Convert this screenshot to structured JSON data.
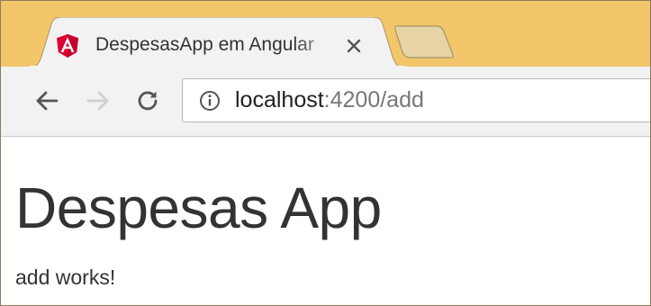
{
  "browser": {
    "tab": {
      "title": "DespesasApp em Angular",
      "favicon": "angular-logo-icon",
      "close_icon": "close-icon"
    },
    "new_tab_icon": "new-tab-icon",
    "toolbar": {
      "back_icon": "arrow-left-icon",
      "forward_icon": "arrow-right-icon",
      "reload_icon": "reload-icon",
      "info_icon": "info-icon"
    },
    "address": {
      "host": "localhost",
      "rest": ":4200/add"
    },
    "colors": {
      "tabstrip": "#f3c66b",
      "toolbar": "#f2f2f2",
      "angular_red": "#dd0031"
    }
  },
  "page": {
    "title": "Despesas App",
    "text": "add works!"
  }
}
